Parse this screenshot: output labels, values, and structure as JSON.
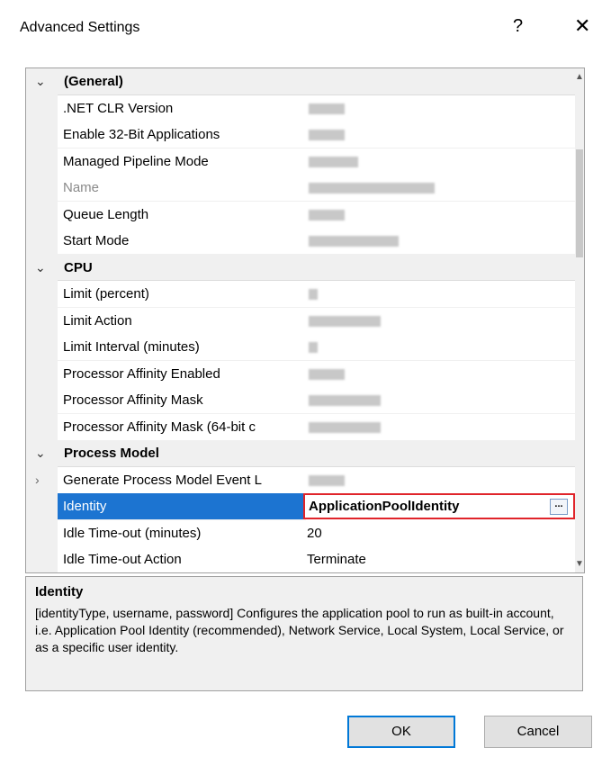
{
  "window": {
    "title": "Advanced Settings",
    "help_glyph": "?",
    "close_glyph": "✕"
  },
  "grid": {
    "rows": [
      {
        "type": "category",
        "label": "(General)"
      },
      {
        "type": "prop",
        "name": ".NET CLR Version",
        "value": ""
      },
      {
        "type": "prop",
        "name": "Enable 32-Bit Applications",
        "value": ""
      },
      {
        "type": "prop",
        "name": "Managed Pipeline Mode",
        "value": ""
      },
      {
        "type": "prop",
        "name": "Name",
        "value": "",
        "disabled": true
      },
      {
        "type": "prop",
        "name": "Queue Length",
        "value": ""
      },
      {
        "type": "prop",
        "name": "Start Mode",
        "value": ""
      },
      {
        "type": "category",
        "label": "CPU"
      },
      {
        "type": "prop",
        "name": "Limit (percent)",
        "value": ""
      },
      {
        "type": "prop",
        "name": "Limit Action",
        "value": ""
      },
      {
        "type": "prop",
        "name": "Limit Interval (minutes)",
        "value": ""
      },
      {
        "type": "prop",
        "name": "Processor Affinity Enabled",
        "value": ""
      },
      {
        "type": "prop",
        "name": "Processor Affinity Mask",
        "value": ""
      },
      {
        "type": "prop",
        "name": "Processor Affinity Mask (64-bit c",
        "value": ""
      },
      {
        "type": "category",
        "label": "Process Model"
      },
      {
        "type": "prop",
        "name": "Generate Process Model Event L",
        "value": "",
        "expandable": true
      },
      {
        "type": "prop",
        "name": "Identity",
        "value": "ApplicationPoolIdentity",
        "selected": true
      },
      {
        "type": "prop",
        "name": "Idle Time-out (minutes)",
        "value": "20"
      },
      {
        "type": "prop",
        "name": "Idle Time-out Action",
        "value": "Terminate"
      }
    ],
    "ellipsis_label": "...",
    "expand_glyph": "›",
    "collapse_glyph": "⌄"
  },
  "help": {
    "title": "Identity",
    "text": "[identityType, username, password] Configures the application pool to run as built-in account, i.e. Application Pool Identity (recommended), Network Service, Local System, Local Service, or as a specific user identity."
  },
  "buttons": {
    "ok": "OK",
    "cancel": "Cancel"
  },
  "colors": {
    "selection": "#1c74d1",
    "highlight_border": "#e0242a"
  }
}
